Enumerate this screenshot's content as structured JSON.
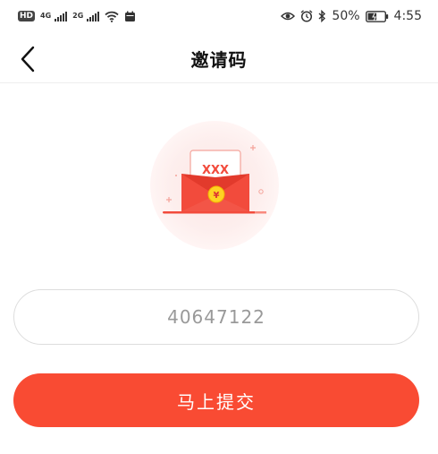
{
  "status_bar": {
    "hd": "HD",
    "sim1_net": "4G",
    "sim2_net": "2G",
    "battery_percent": "50%",
    "time": "4:55",
    "icons": [
      "hd-icon",
      "signal-icon",
      "signal-icon",
      "wifi-icon",
      "calendar-icon",
      "eye-icon",
      "alarm-icon",
      "bluetooth-icon",
      "battery-icon"
    ]
  },
  "header": {
    "title": "邀请码",
    "back_icon": "chevron-left-icon"
  },
  "illustration": {
    "envelope_text": "XXX",
    "coin_symbol": "¥",
    "icon": "red-envelope-icon"
  },
  "form": {
    "invite_code_value": "40647122",
    "submit_label": "马上提交"
  },
  "colors": {
    "accent": "#f94b33",
    "envelope_red": "#f24b3c",
    "coin_yellow": "#ffd323"
  }
}
